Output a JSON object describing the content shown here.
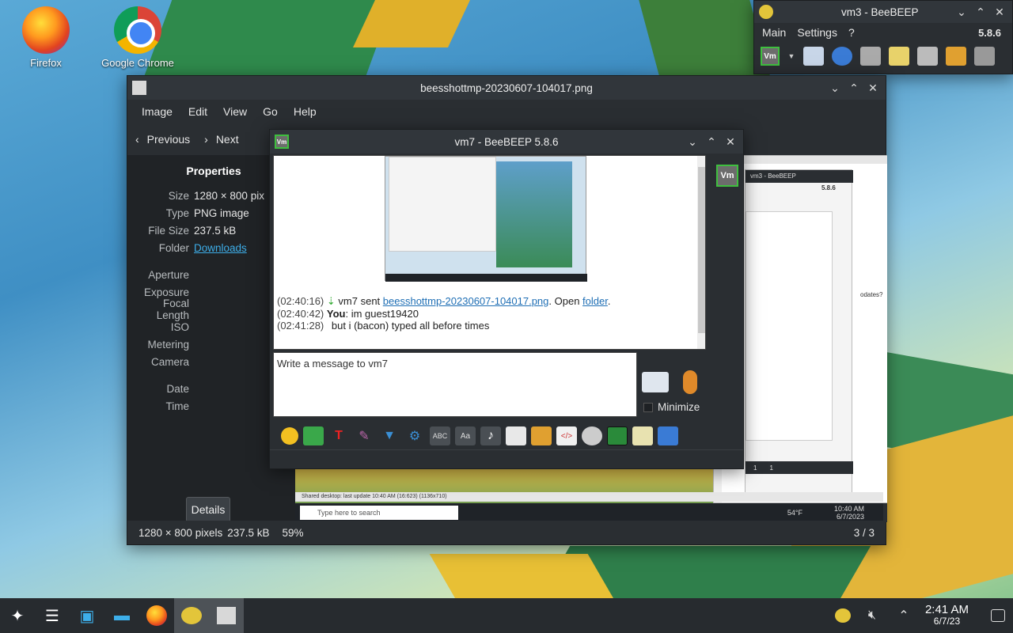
{
  "desktop": {
    "icons": [
      {
        "label": "Firefox"
      },
      {
        "label": "Google Chrome"
      }
    ]
  },
  "viewer": {
    "title": "beesshottmp-20230607-104017.png",
    "menu": [
      "Image",
      "Edit",
      "View",
      "Go",
      "Help"
    ],
    "toolbar": {
      "previous": "Previous",
      "next": "Next"
    },
    "properties": {
      "heading": "Properties",
      "rows": [
        {
          "key": "Size",
          "value": "1280 × 800 pix"
        },
        {
          "key": "Type",
          "value": "PNG image"
        },
        {
          "key": "File Size",
          "value": "237.5 kB"
        },
        {
          "key": "Folder",
          "value": "Downloads"
        }
      ],
      "exif_rows": [
        {
          "key": "Aperture",
          "value": ""
        },
        {
          "key": "Exposure",
          "value": ""
        },
        {
          "key": "Focal Length",
          "value": ""
        },
        {
          "key": "ISO",
          "value": ""
        },
        {
          "key": "Metering",
          "value": ""
        },
        {
          "key": "Camera",
          "value": ""
        }
      ],
      "time_rows": [
        {
          "key": "Date",
          "value": ""
        },
        {
          "key": "Time",
          "value": ""
        }
      ],
      "details_button": "Details"
    },
    "status": {
      "dimensions": "1280 × 800 pixels",
      "size": "237.5 kB",
      "zoom": "59%",
      "pages": "3 / 3"
    },
    "preview": {
      "shared_desktop_status": "Shared desktop: last update 10:40 AM (16:623) (1136x710)",
      "taskbar_search": "Type here to search",
      "temp": "54°F",
      "time": "10:40 AM",
      "date": "6/7/2023",
      "window_title": "vm3 - BeeBEEP",
      "version": "5.8.6",
      "updates_text": "odates?",
      "counts": [
        "1",
        "1"
      ]
    }
  },
  "chat": {
    "title": "vm7 - BeeBEEP 5.8.6",
    "avatar": "Vm",
    "messages": [
      {
        "time": "(02:40:16)",
        "prefix": "vm7 sent ",
        "link": "beesshottmp-20230607-104017.png",
        "mid": ". Open ",
        "link2": "folder",
        "suffix": "."
      },
      {
        "time": "(02:40:42)",
        "sender": "You",
        "text": ": im guest19420"
      },
      {
        "time": "(02:41:28)",
        "text": "but i (bacon) typed all before times"
      }
    ],
    "input_placeholder": "Write a message to vm7",
    "minimize_label": "Minimize"
  },
  "vm3": {
    "title": "vm3 - BeeBEEP",
    "menu": [
      "Main",
      "Settings",
      "?"
    ],
    "version": "5.8.6",
    "avatar": "Vm"
  },
  "taskbar": {
    "time": "2:41 AM",
    "date": "6/7/23"
  }
}
